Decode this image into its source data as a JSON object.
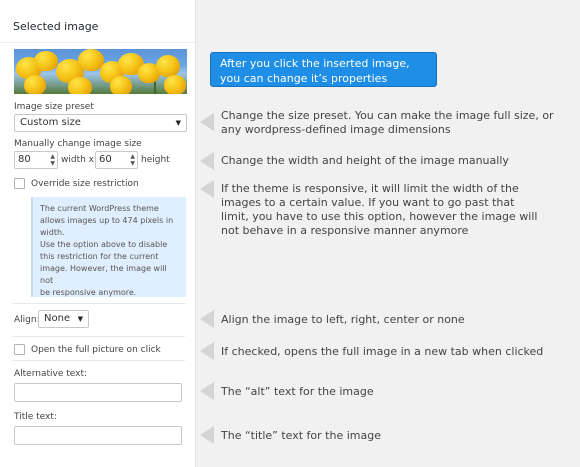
{
  "panel": {
    "title": "Selected image",
    "size_preset_label": "Image size preset",
    "size_preset_value": "Custom size",
    "manual_size_label": "Manually change image size",
    "width_value": "80",
    "width_suffix": "width x",
    "height_value": "60",
    "height_suffix": "height",
    "override_label": "Override size restriction",
    "info_lines": [
      "The current WordPress theme",
      "allows images up to 474 pixels in",
      "width.",
      "Use the option above to disable",
      "this restriction for the current",
      "image. However, the image will not",
      "be responsive anymore."
    ],
    "align_label": "Align:",
    "align_value": "None",
    "open_full_label": "Open the full picture on click",
    "alt_label": "Alternative text:",
    "alt_value": "",
    "title_label": "Title text:",
    "title_value": ""
  },
  "callout": {
    "line1": "After you click the inserted image,",
    "line2": "you can change it’s properties"
  },
  "notes": {
    "size_preset": [
      "Change the size preset. You can make the image full size, or",
      "any wordpress-defined image dimensions"
    ],
    "manual_size": "Change the width and height of the image manually",
    "override": [
      "If the theme is responsive, it will limit the width of the",
      "images to a certain value. If you want to go past that",
      "limit, you have to use this option, however the image will",
      "not behave in a responsive manner anymore"
    ],
    "align": "Align the image to left, right, center or none",
    "open_full": "If checked, opens the full image in a new tab when clicked",
    "alt": "The “alt” text for the image",
    "title": "The “title” text for the image"
  },
  "icons": {
    "pointer_arrow": "left-pointer-arrow-icon",
    "dropdown": "chevron-down-icon",
    "spinner": "spin-arrows-icon"
  },
  "colors": {
    "callout_bg": "#1e8ee6",
    "info_bg": "#e0efff",
    "arrow": "#d4d4d4"
  }
}
